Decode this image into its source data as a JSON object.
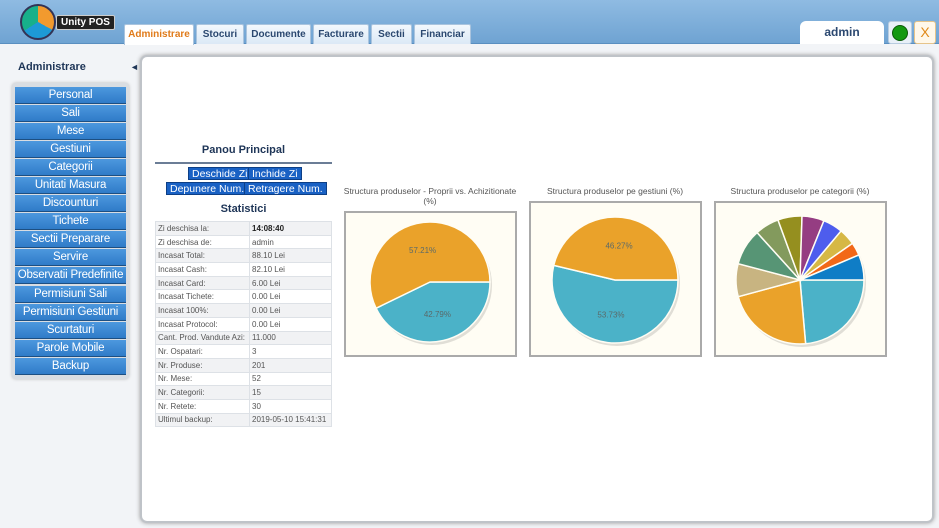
{
  "app": {
    "logo_text": "Unity POS",
    "user": "admin",
    "close_label": "X",
    "status_color": "#129912"
  },
  "tabs": [
    "Administrare",
    "Stocuri",
    "Documente",
    "Facturare",
    "Sectii",
    "Financiar"
  ],
  "sidebar": {
    "title": "Administrare",
    "toggle": "◄",
    "items": [
      "Personal",
      "Sali",
      "Mese",
      "Gestiuni",
      "Categorii",
      "Unitati Masura",
      "Discounturi",
      "Tichete",
      "Sectii Preparare",
      "Servire",
      "Observatii Predefinite",
      "Permisiuni Sali",
      "Permisiuni Gestiuni",
      "Scurtaturi",
      "Parole Mobile",
      "Backup"
    ]
  },
  "panel": {
    "title": "Panou Principal",
    "buttons": [
      "Deschide Zi",
      "Inchide Zi",
      "Depunere Num.",
      "Retragere Num."
    ],
    "stats_title": "Statistici",
    "stats": [
      [
        "Zi deschisa la:",
        "14:08:40"
      ],
      [
        "Zi deschisa de:",
        "admin"
      ],
      [
        "Incasat Total:",
        "88.10 Lei"
      ],
      [
        "Incasat Cash:",
        "82.10 Lei"
      ],
      [
        "Incasat Card:",
        "6.00 Lei"
      ],
      [
        "Incasat Tichete:",
        "0.00 Lei"
      ],
      [
        "Incasat 100%:",
        "0.00 Lei"
      ],
      [
        "Incasat Protocol:",
        "0.00 Lei"
      ],
      [
        "Cant. Prod. Vandute Azi:",
        "11.000"
      ],
      [
        "Nr. Ospatari:",
        "3"
      ],
      [
        "Nr. Produse:",
        "201"
      ],
      [
        "Nr. Mese:",
        "52"
      ],
      [
        "Nr. Categorii:",
        "15"
      ],
      [
        "Nr. Retete:",
        "30"
      ],
      [
        "Ultimul backup:",
        "2019-05-10 15:41:31"
      ]
    ]
  },
  "chart_data": [
    {
      "type": "pie",
      "title": "Structura produselor - Proprii vs. Achizitionate (%)",
      "values": [
        42.79,
        57.21
      ],
      "labels": [
        "42.79%",
        "57.21%"
      ],
      "colors": [
        "#4bb2c8",
        "#eaa22a"
      ]
    },
    {
      "type": "pie",
      "title": "Structura produselor pe gestiuni (%)",
      "values": [
        53.73,
        46.27
      ],
      "labels": [
        "53.73%",
        "46.27%"
      ],
      "colors": [
        "#4bb2c8",
        "#eaa22a"
      ]
    },
    {
      "type": "pie",
      "title": "Structura produselor pe categorii (%)",
      "values": [
        23.6,
        22.2,
        8.3,
        9.2,
        6.1,
        6.1,
        5.6,
        5.0,
        4.2,
        3.3,
        6.4
      ],
      "labels": [],
      "colors": [
        "#4bb2c8",
        "#eaa22a",
        "#c8b481",
        "#579575",
        "#839a5d",
        "#958f1f",
        "#953d82",
        "#4e5ded",
        "#d6b845",
        "#f26818",
        "#0f7dc6"
      ]
    }
  ]
}
